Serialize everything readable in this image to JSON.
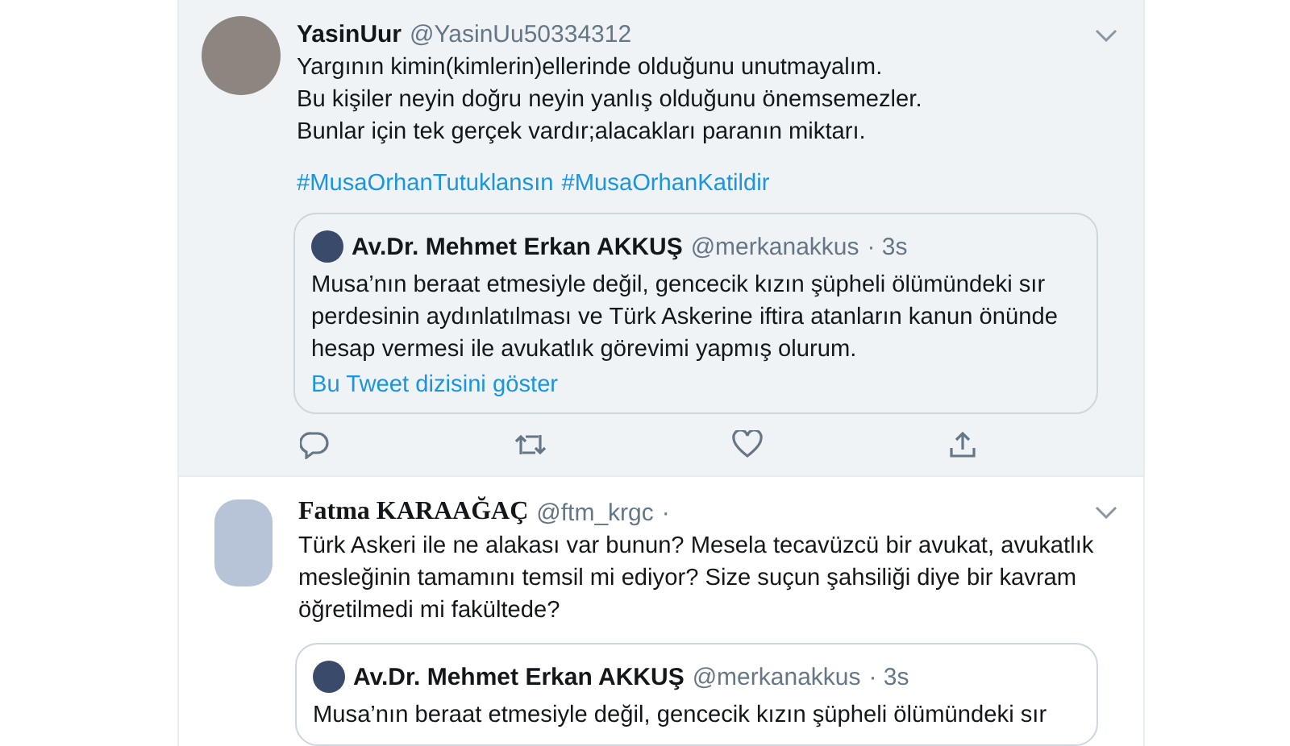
{
  "tweets": [
    {
      "name": "YasinUur",
      "handle": "@YasinUu50334312",
      "hovered": true,
      "body": "Yargının kimin(kimlerin)ellerinde olduğunu unutmayalım.\nBu kişiler neyin doğru neyin yanlış olduğunu önemsemezler.\nBunlar için tek gerçek vardır;alacakları paranın miktarı.",
      "hashtags": [
        "#MusaOrhanTutuklansın",
        "#MusaOrhanKatildir"
      ],
      "quote": {
        "name": "Av.Dr. Mehmet Erkan AKKUŞ",
        "handle": "@merkanakkus",
        "time": "· 3s",
        "body": "Musa’nın beraat etmesiyle değil, gencecik kızın şüpheli ölümündeki sır\nperdesinin aydınlatılması ve Türk Askerine iftira atanların kanun önünde\nhesap vermesi ile avukatlık görevimi yapmış olurum.",
        "link": "Bu Tweet dizisini göster"
      }
    },
    {
      "name": "Fatma KARAAĞAÇ",
      "handle": "@ftm_krgc",
      "time": "·",
      "hovered": false,
      "body": "Türk Askeri ile ne alakası var bunun? Mesela tecavüzcü bir avukat, avukatlık\nmesleğinin tamamını temsil mi ediyor? Size suçun şahsiliği diye bir kavram\nöğretilmedi mi fakültede?",
      "quote": {
        "name": "Av.Dr. Mehmet Erkan AKKUŞ",
        "handle": "@merkanakkus",
        "time": "· 3s",
        "body": "Musa’nın beraat etmesiyle değil, gencecik kızın şüpheli ölümündeki sır"
      }
    }
  ]
}
